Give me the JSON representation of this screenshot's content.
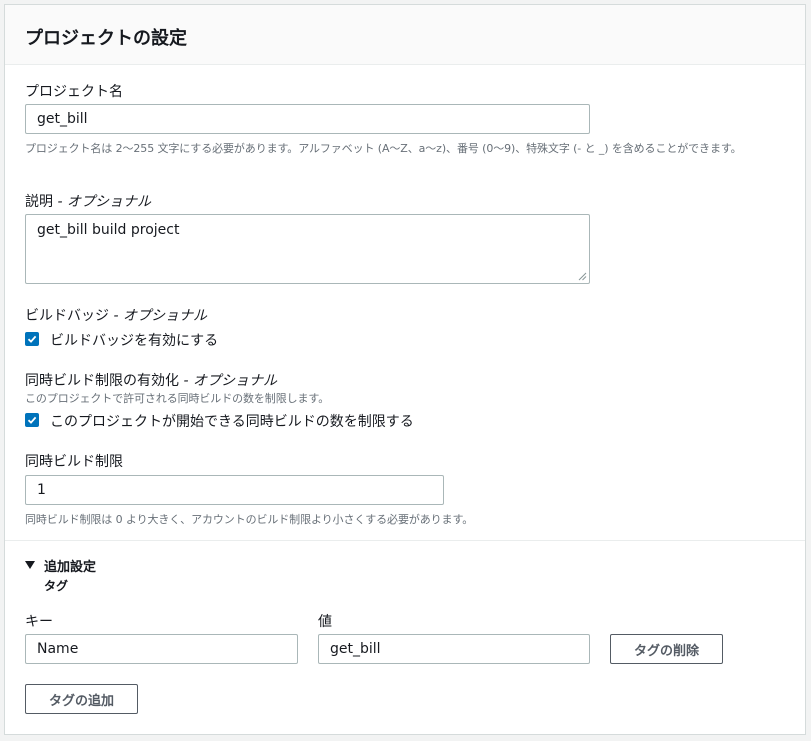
{
  "panel": {
    "title": "プロジェクトの設定"
  },
  "project_name": {
    "label": "プロジェクト名",
    "value": "get_bill",
    "hint": "プロジェクト名は 2〜255 文字にする必要があります。アルファベット (A〜Z、a〜z)、番号 (0〜9)、特殊文字 (- と _) を含めることができます。"
  },
  "description": {
    "label": "説明",
    "optional": "- オプショナル",
    "value": "get_bill build project"
  },
  "build_badge": {
    "label": "ビルドバッジ",
    "optional": "- オプショナル",
    "checkbox_label": "ビルドバッジを有効にする",
    "checked": true
  },
  "concurrent_limit": {
    "label": "同時ビルド制限の有効化",
    "optional": "- オプショナル",
    "hint": "このプロジェクトで許可される同時ビルドの数を制限します。",
    "checkbox_label": "このプロジェクトが開始できる同時ビルドの数を制限する",
    "checked": true
  },
  "concurrent_limit_value": {
    "label": "同時ビルド制限",
    "value": "1",
    "hint": "同時ビルド制限は 0 より大きく、アカウントのビルド制限より小さくする必要があります。"
  },
  "additional": {
    "label": "追加設定",
    "expanded": true,
    "tags_label": "タグ",
    "key_label": "キー",
    "value_label": "値",
    "tag_key": "Name",
    "tag_value": "get_bill",
    "remove_tag_button": "タグの削除",
    "add_tag_button": "タグの追加"
  },
  "colors": {
    "accent": "#0073bb",
    "border": "#aab7b8",
    "hint": "#687078",
    "button_border": "#545b64"
  }
}
